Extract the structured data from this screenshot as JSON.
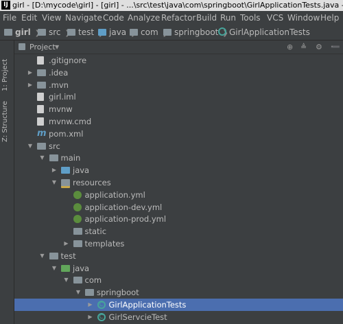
{
  "title_bar": {
    "text": "girl - [D:\\mycode\\girl] - [girl] - ...\\src\\test\\java\\com\\springboot\\GirlApplicationTests.java - IntelliJ IDEA"
  },
  "menu": [
    "File",
    "Edit",
    "View",
    "Navigate",
    "Code",
    "Analyze",
    "Refactor",
    "Build",
    "Run",
    "Tools",
    "VCS",
    "Window",
    "Help"
  ],
  "breadcrumbs": [
    "girl",
    "src",
    "test",
    "java",
    "com",
    "springboot",
    "GirlApplicationTests"
  ],
  "side_tabs": {
    "project": "1: Project",
    "structure": "Z: Structure"
  },
  "panel": {
    "title": "Project"
  },
  "tree": [
    {
      "label": ".gitignore",
      "depth": 1,
      "arrow": "none",
      "icon": "file-icon"
    },
    {
      "label": ".idea",
      "depth": 1,
      "arrow": "collapsed",
      "icon": "folder-icon"
    },
    {
      "label": ".mvn",
      "depth": 1,
      "arrow": "collapsed",
      "icon": "folder-icon"
    },
    {
      "label": "girl.iml",
      "depth": 1,
      "arrow": "none",
      "icon": "file-icon"
    },
    {
      "label": "mvnw",
      "depth": 1,
      "arrow": "none",
      "icon": "file-icon"
    },
    {
      "label": "mvnw.cmd",
      "depth": 1,
      "arrow": "none",
      "icon": "file-icon"
    },
    {
      "label": "pom.xml",
      "depth": 1,
      "arrow": "none",
      "icon": "maven-icon"
    },
    {
      "label": "src",
      "depth": 1,
      "arrow": "expanded",
      "icon": "folder-icon"
    },
    {
      "label": "main",
      "depth": 2,
      "arrow": "expanded",
      "icon": "folder-icon"
    },
    {
      "label": "java",
      "depth": 3,
      "arrow": "collapsed",
      "icon": "source-folder-icon"
    },
    {
      "label": "resources",
      "depth": 3,
      "arrow": "expanded",
      "icon": "resources-folder-icon"
    },
    {
      "label": "application.yml",
      "depth": 4,
      "arrow": "none",
      "icon": "yml-icon"
    },
    {
      "label": "application-dev.yml",
      "depth": 4,
      "arrow": "none",
      "icon": "yml-icon"
    },
    {
      "label": "application-prod.yml",
      "depth": 4,
      "arrow": "none",
      "icon": "yml-icon"
    },
    {
      "label": "static",
      "depth": 4,
      "arrow": "none",
      "icon": "folder-icon"
    },
    {
      "label": "templates",
      "depth": 4,
      "arrow": "collapsed",
      "icon": "folder-icon"
    },
    {
      "label": "test",
      "depth": 2,
      "arrow": "expanded",
      "icon": "folder-icon"
    },
    {
      "label": "java",
      "depth": 3,
      "arrow": "expanded",
      "icon": "test-folder-icon"
    },
    {
      "label": "com",
      "depth": 4,
      "arrow": "expanded",
      "icon": "folder-icon"
    },
    {
      "label": "springboot",
      "depth": 5,
      "arrow": "expanded",
      "icon": "folder-icon"
    },
    {
      "label": "GirlApplicationTests",
      "depth": 6,
      "arrow": "collapsed",
      "icon": "test-class-icon",
      "selected": true
    },
    {
      "label": "GirlServcieTest",
      "depth": 6,
      "arrow": "collapsed",
      "icon": "test-class-icon"
    }
  ],
  "colors": {
    "background": "#3c3f41",
    "selection": "#4b6eaf",
    "text": "#bbbbbb"
  }
}
